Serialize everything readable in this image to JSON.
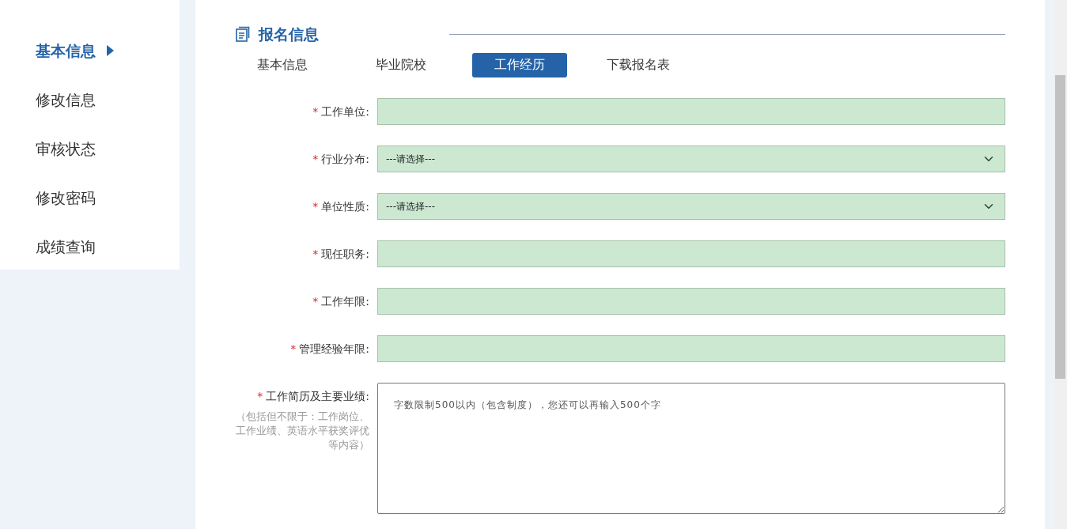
{
  "sidebar": {
    "items": [
      {
        "label": "基本信息",
        "selected": true
      },
      {
        "label": "修改信息",
        "selected": false
      },
      {
        "label": "审核状态",
        "selected": false
      },
      {
        "label": "修改密码",
        "selected": false
      },
      {
        "label": "成绩查询",
        "selected": false
      }
    ]
  },
  "section": {
    "title": "报名信息"
  },
  "tabs": [
    {
      "label": "基本信息",
      "selected": false
    },
    {
      "label": "毕业院校",
      "selected": false
    },
    {
      "label": "工作经历",
      "selected": true
    },
    {
      "label": "下载报名表",
      "selected": false
    }
  ],
  "form": {
    "fields": [
      {
        "kind": "text",
        "required_mark": "*",
        "label": "工作单位:"
      },
      {
        "kind": "select",
        "required_mark": "*",
        "label": "行业分布:",
        "value": "---请选择---"
      },
      {
        "kind": "select",
        "required_mark": "*",
        "label": "单位性质:",
        "value": "---请选择---"
      },
      {
        "kind": "text",
        "required_mark": "*",
        "label": "现任职务:"
      },
      {
        "kind": "text",
        "required_mark": "*",
        "label": "工作年限:"
      },
      {
        "kind": "text",
        "required_mark": "*",
        "label": "管理经验年限:"
      },
      {
        "kind": "textarea",
        "required_mark": "*",
        "label": "工作简历及主要业绩:",
        "hint": "（包括但不限于：工作岗位、工作业绩、英语水平获奖评优等内容）",
        "value": "字数限制500以内（包含制度），您还可以再输入500个字"
      }
    ]
  }
}
